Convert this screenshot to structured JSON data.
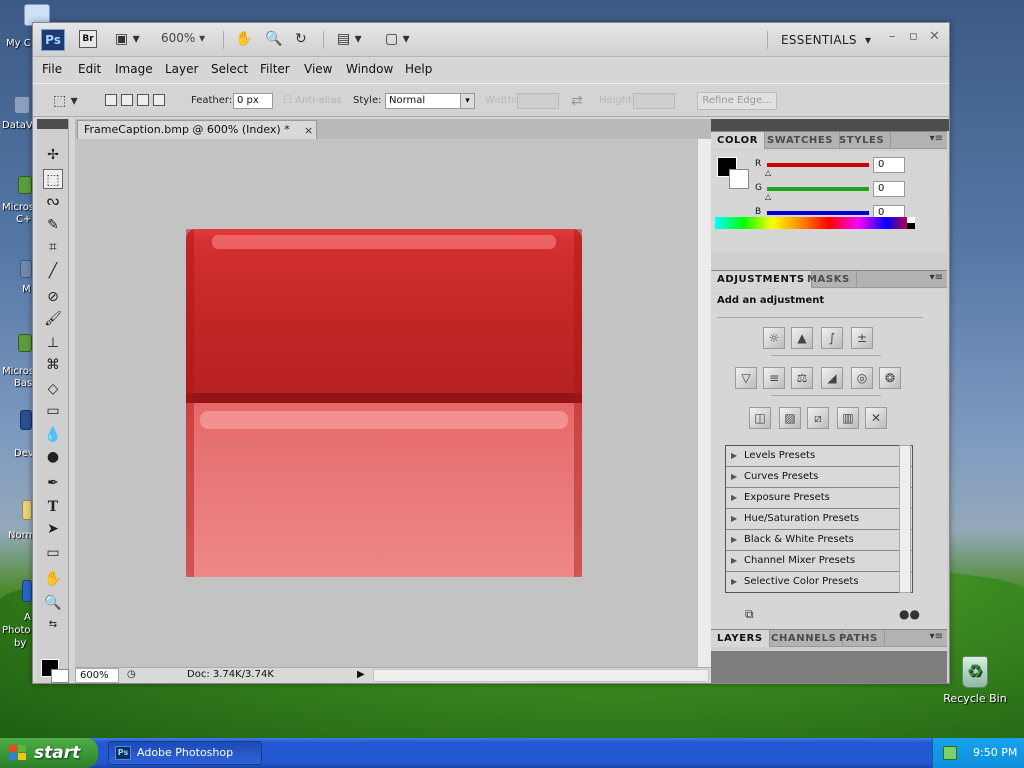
{
  "desktop": {
    "partial_labels": [
      "My C",
      "DataV",
      "Micros",
      "C+",
      "M",
      "Micros",
      "Bas",
      "Dev",
      "Norm",
      "A",
      "Photo",
      "by"
    ],
    "recycle_bin_label": "Recycle Bin"
  },
  "taskbar": {
    "start_label": "start",
    "task_label": "Adobe Photoshop CS...",
    "clock": "9:50 PM"
  },
  "appbar": {
    "ps_logo": "Ps",
    "br_logo": "Br",
    "zoom_value": "600%",
    "workspace": "ESSENTIALS"
  },
  "menus": [
    "File",
    "Edit",
    "Image",
    "Layer",
    "Select",
    "Filter",
    "View",
    "Window",
    "Help"
  ],
  "options": {
    "feather_label": "Feather:",
    "feather_value": "0 px",
    "antialias_label": "Anti-alias",
    "style_label": "Style:",
    "style_value": "Normal",
    "width_label": "Width:",
    "height_label": "Height:",
    "refine_edge": "Refine Edge..."
  },
  "document": {
    "tab_title": "FrameCaption.bmp @ 600% (Index) *",
    "close_glyph": "×",
    "zoom_field": "600%",
    "doc_info": "Doc: 3.74K/3.74K"
  },
  "color_panel": {
    "tabs": [
      "COLOR",
      "SWATCHES",
      "STYLES"
    ],
    "r_label": "R",
    "g_label": "G",
    "b_label": "B",
    "r_value": "0",
    "g_value": "0",
    "b_value": "0",
    "colors": {
      "red_bar": "#cc0000",
      "green_bar": "#1ea51e",
      "blue_bar": "#0000cc"
    }
  },
  "adjustments_panel": {
    "tabs": [
      "ADJUSTMENTS",
      "MASKS"
    ],
    "title": "Add an adjustment",
    "presets": [
      "Levels Presets",
      "Curves Presets",
      "Exposure Presets",
      "Hue/Saturation Presets",
      "Black & White Presets",
      "Channel Mixer Presets",
      "Selective Color Presets"
    ]
  },
  "layers_panel": {
    "tabs": [
      "LAYERS",
      "CHANNELS",
      "PATHS"
    ]
  }
}
